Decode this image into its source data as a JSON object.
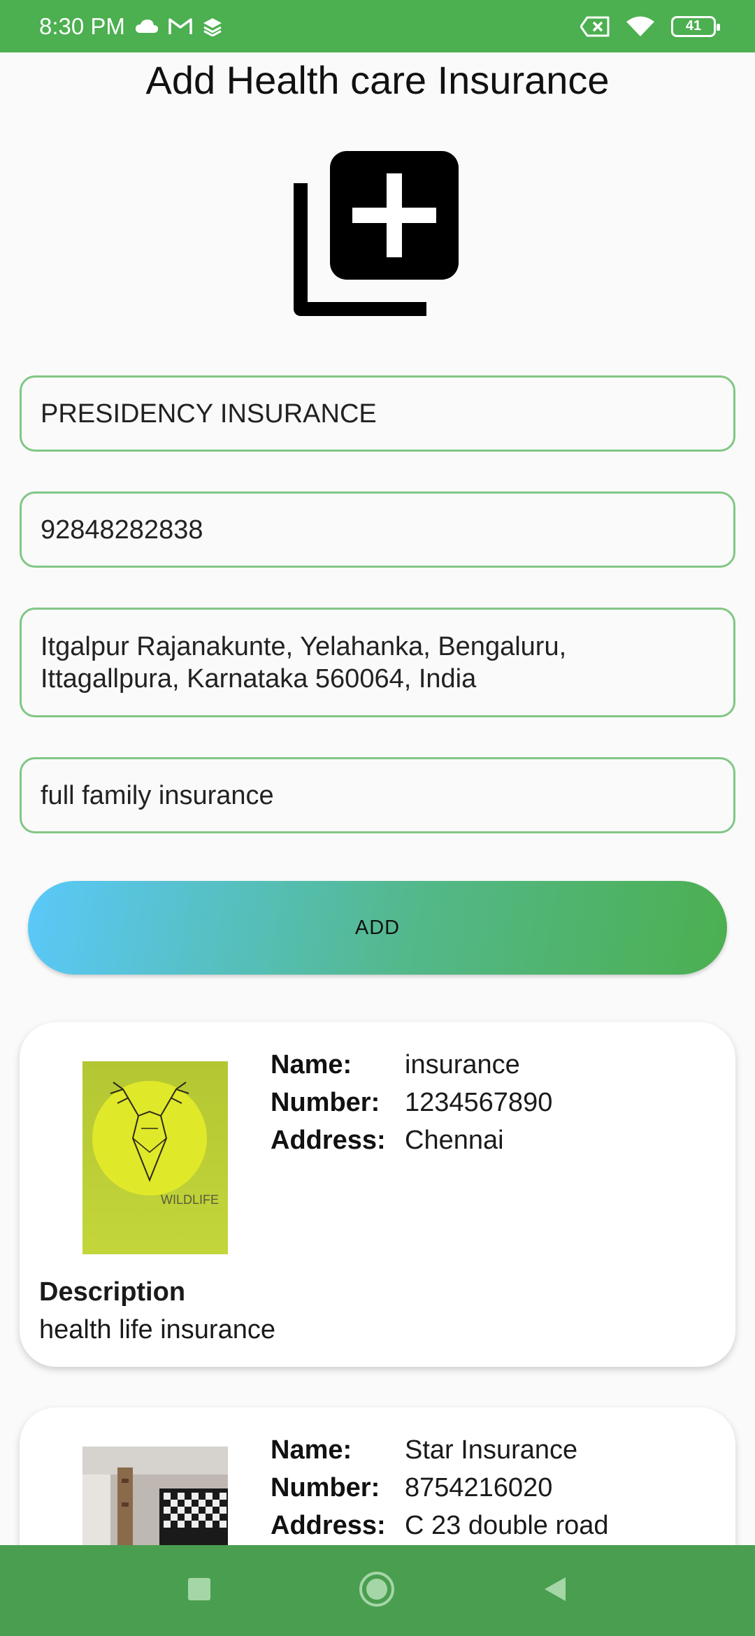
{
  "status_bar": {
    "time": "8:30 PM",
    "battery": "41",
    "icons": [
      "cloud-icon",
      "gmail-icon",
      "layers-icon",
      "battery-x-icon",
      "wifi-icon",
      "battery-icon"
    ]
  },
  "page": {
    "title": "Add Health care Insurance",
    "add_photo_icon": "add-photo-icon"
  },
  "form": {
    "name_value": "PRESIDENCY INSURANCE",
    "number_value": "92848282838",
    "address_value": "Itgalpur Rajanakunte, Yelahanka, Bengaluru,\nIttagallpura, Karnataka 560064, India",
    "description_value": "full family insurance",
    "add_button_label": "ADD"
  },
  "labels": {
    "name": "Name:",
    "number": "Number:",
    "address": "Address:",
    "description": "Description"
  },
  "cards": [
    {
      "name": "insurance",
      "number": "1234567890",
      "address": "Chennai",
      "description": "health life insurance",
      "thumb_text": "WILDLIFE"
    },
    {
      "name": "Star Insurance",
      "number": "8754216020",
      "address": "C 23 double road"
    }
  ],
  "colors": {
    "primary": "#4caf50",
    "field_border": "#81c784",
    "button_gradient_start": "#5ac8fa",
    "button_gradient_end": "#4caf50"
  }
}
